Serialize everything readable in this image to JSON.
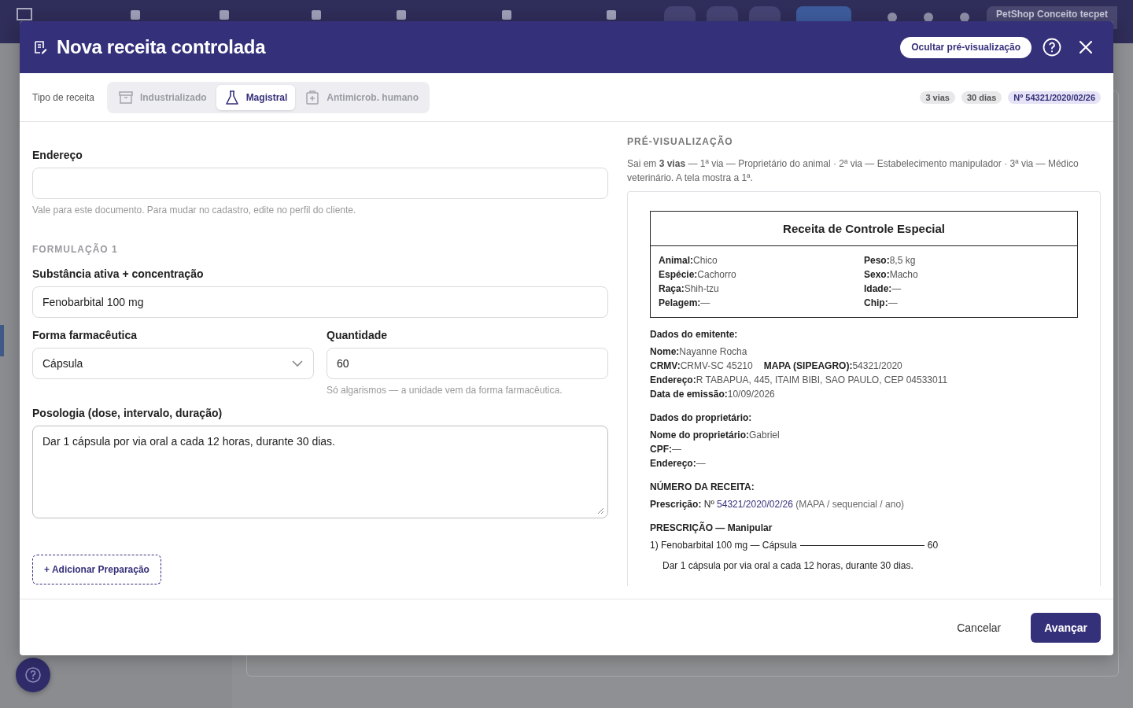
{
  "app_bar": {
    "account": "PetShop Conceito tecpet"
  },
  "modal": {
    "title": "Nova receita controlada",
    "preview_toggle": "Ocultar pré-visualização",
    "type_label": "Tipo de receita",
    "types": [
      {
        "label": "Industrializado",
        "kind": "box",
        "selected": false
      },
      {
        "label": "Magistral",
        "kind": "flask",
        "selected": true
      },
      {
        "label": "Antimicrob. humano",
        "kind": "medkit",
        "selected": false
      }
    ],
    "badges": [
      {
        "text": "3 vias",
        "kind": "neutral"
      },
      {
        "text": "30 dias",
        "kind": "neutral"
      },
      {
        "text": "Nº 54321/2020/02/26",
        "kind": "accent"
      }
    ],
    "form": {
      "address": {
        "label": "Endereço",
        "hint": "Vale para este documento. Para mudar no cadastro, edite no perfil do cliente."
      },
      "section": "FORMULAÇÃO 1",
      "substance": {
        "label": "Substância ativa + concentração",
        "value": "Fenobarbital 100 mg"
      },
      "dosage_form": {
        "label": "Forma farmacêutica",
        "value": "Cápsula"
      },
      "quantity": {
        "label": "Quantidade",
        "value": "60",
        "hint": "Só algarismos — a unidade vem da forma farmacêutica."
      },
      "posology": {
        "label": "Posologia (dose, intervalo, duração)",
        "value": "Dar 1 cápsula por via oral a cada 12 horas, durante 30 dias."
      },
      "add_button": "+ Adicionar Preparação"
    },
    "preview": {
      "heading": "PRÉ-VISUALIZAÇÃO",
      "note": "Sai em **3 vias** — 1ª via — Proprietário do animal · 2ª via — Estabelecimento manipulador · 3ª via — Médico veterinário. A tela mostra a 1ª.",
      "document": {
        "title": "Receita de Controle Especial",
        "animal_fields": [
          {
            "label": "Animal:",
            "value": "Chico"
          },
          {
            "label": "Peso:",
            "value": "8,5 kg"
          },
          {
            "label": "Espécie:",
            "value": "Cachorro"
          },
          {
            "label": "Sexo:",
            "value": "Macho"
          },
          {
            "label": "Raça:",
            "value": "Shih-tzu"
          },
          {
            "label": "Idade:",
            "value": "—"
          },
          {
            "label": "Pelagem:",
            "value": "—"
          },
          {
            "label": "Chip:",
            "value": "—"
          }
        ],
        "issuer": {
          "heading": "Dados do emitente:",
          "lines": [
            [
              {
                "label": "Nome:",
                "value": "Nayanne Rocha"
              }
            ],
            [
              {
                "label": "CRMV:",
                "value": "CRMV-SC 45210"
              },
              {
                "label": "MAPA (SIPEAGRO):",
                "value": "54321/2020"
              }
            ],
            [
              {
                "label": "Endereço:",
                "value": "R TABAPUA, 445, ITAIM BIBI, SAO PAULO, CEP 04533011"
              }
            ],
            [
              {
                "label": "Data de emissão:",
                "value": "10/09/2026"
              }
            ]
          ]
        },
        "owner": {
          "heading": "Dados do proprietário:",
          "lines": [
            [
              {
                "label": "Nome do proprietário:",
                "value": "Gabriel"
              }
            ],
            [
              {
                "label": "CPF:",
                "value": "—"
              }
            ],
            [
              {
                "label": "Endereço:",
                "value": "—"
              }
            ]
          ]
        },
        "number": {
          "heading": "NÚMERO DA RECEITA:",
          "label": "Prescrição:",
          "prefix": "Nº",
          "value": "54321/2020/02/26",
          "note": "(MAPA / sequencial / ano)"
        },
        "prescription": {
          "heading": "PRESCRIÇÃO — Manipular",
          "items": [
            {
              "text": "1) Fenobarbital 100 mg — Cápsula",
              "quantity": "60",
              "posology": "Dar 1 cápsula por via oral a cada 12 horas, durante 30 dias."
            }
          ]
        }
      }
    },
    "footer": {
      "cancel": "Cancelar",
      "next": "Avançar"
    }
  }
}
